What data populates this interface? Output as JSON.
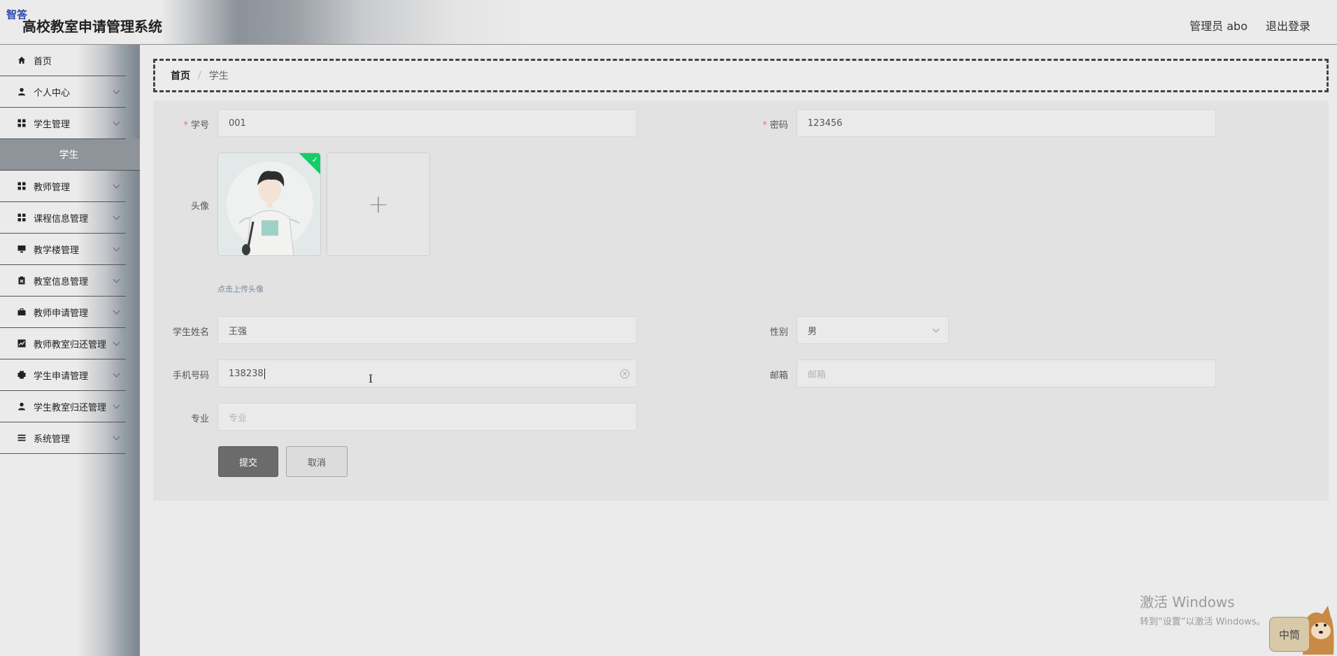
{
  "header": {
    "badge": "智答",
    "title": "高校教室申请管理系统",
    "user": "管理员 abo",
    "logout": "退出登录"
  },
  "sidebar": {
    "items": [
      {
        "label": "首页",
        "icon": "home-icon",
        "has_arrow": false
      },
      {
        "label": "个人中心",
        "icon": "user-icon",
        "has_arrow": true
      },
      {
        "label": "学生管理",
        "icon": "grid-icon",
        "has_arrow": true
      },
      {
        "label": "学生",
        "submenu": true
      },
      {
        "label": "教师管理",
        "icon": "grid-icon",
        "has_arrow": true
      },
      {
        "label": "课程信息管理",
        "icon": "grid-icon",
        "has_arrow": true
      },
      {
        "label": "教学楼管理",
        "icon": "monitor-icon",
        "has_arrow": true
      },
      {
        "label": "教室信息管理",
        "icon": "clipboard-icon",
        "has_arrow": true
      },
      {
        "label": "教师申请管理",
        "icon": "briefcase-icon",
        "has_arrow": true
      },
      {
        "label": "教师教室归还管理",
        "icon": "chart-icon",
        "has_arrow": true
      },
      {
        "label": "学生申请管理",
        "icon": "printer-icon",
        "has_arrow": true
      },
      {
        "label": "学生教室归还管理",
        "icon": "user-icon",
        "has_arrow": true
      },
      {
        "label": "系统管理",
        "icon": "list-icon",
        "has_arrow": true
      }
    ]
  },
  "breadcrumb": {
    "home": "首页",
    "separator": "/",
    "current": "学生"
  },
  "form": {
    "student_id": {
      "label": "学号",
      "value": "001"
    },
    "password": {
      "label": "密码",
      "value": "123456"
    },
    "avatar": {
      "label": "头像",
      "tip": "点击上传头像",
      "upload_symbol": "+"
    },
    "name": {
      "label": "学生姓名",
      "value": "王强"
    },
    "gender": {
      "label": "性别",
      "value": "男"
    },
    "phone": {
      "label": "手机号码",
      "value": "138238"
    },
    "email": {
      "label": "邮箱",
      "placeholder": "邮箱"
    },
    "major": {
      "label": "专业",
      "placeholder": "专业"
    },
    "submit": "提交",
    "cancel": "取消"
  },
  "watermark": {
    "line1": "激活 Windows",
    "line2": "转到“设置”以激活 Windows。"
  },
  "mascot": {
    "tag": "中筒"
  },
  "colors": {
    "required": "#f56c6c",
    "success": "#13ce66",
    "submit_button": "#6b6b6b"
  }
}
